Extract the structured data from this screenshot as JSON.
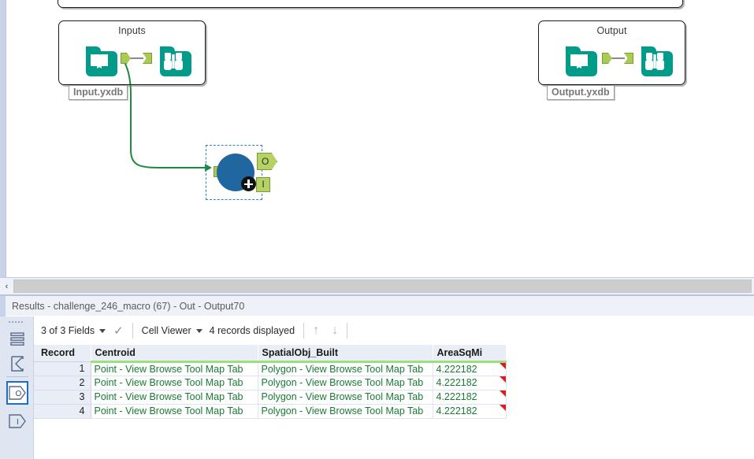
{
  "canvas": {
    "containers": [
      {
        "id": "top",
        "title": ""
      },
      {
        "id": "inputs",
        "title": "Inputs"
      },
      {
        "id": "output",
        "title": "Output"
      }
    ],
    "annotations": {
      "input_label": "Input.yxdb",
      "output_label": "Output.yxdb"
    },
    "macro_node": {
      "output_anchor_label": "O",
      "input_anchor_label": "I"
    },
    "colors": {
      "tool_teal": "#009b89",
      "macro_blue": "#21679f",
      "connector_green": "#aacb52",
      "wire_green": "#1f8a3c",
      "selection_blue": "#2a7fd4"
    },
    "scrollbar": {
      "left_arrow": "‹"
    }
  },
  "results": {
    "title": "Results - challenge_246_macro (67) - Out - Output70",
    "side_strip": [
      {
        "name": "records-icon",
        "glyph": "rows"
      },
      {
        "name": "messages-icon",
        "glyph": "sigma"
      },
      {
        "name": "output-anchor-icon",
        "glyph": "O",
        "selected": true
      },
      {
        "name": "input-anchor-icon",
        "glyph": "I",
        "selected": false
      }
    ],
    "toolbar": {
      "fields_label": "3 of 3 Fields",
      "check_glyph": "✓",
      "cell_viewer_label": "Cell Viewer",
      "records_label": "4 records displayed",
      "up_arrow": "↑",
      "down_arrow": "↓"
    },
    "table": {
      "columns": [
        "Record",
        "Centroid",
        "SpatialObj_Built",
        "AreaSqMi"
      ],
      "rows": [
        {
          "record": "1",
          "centroid": "Point - View Browse Tool Map Tab",
          "spatial": "Polygon - View Browse Tool Map Tab",
          "area": "4.222182"
        },
        {
          "record": "2",
          "centroid": "Point - View Browse Tool Map Tab",
          "spatial": "Polygon - View Browse Tool Map Tab",
          "area": "4.222182"
        },
        {
          "record": "3",
          "centroid": "Point - View Browse Tool Map Tab",
          "spatial": "Polygon - View Browse Tool Map Tab",
          "area": "4.222182"
        },
        {
          "record": "4",
          "centroid": "Point - View Browse Tool Map Tab",
          "spatial": "Polygon - View Browse Tool Map Tab",
          "area": "4.222182"
        }
      ]
    }
  }
}
